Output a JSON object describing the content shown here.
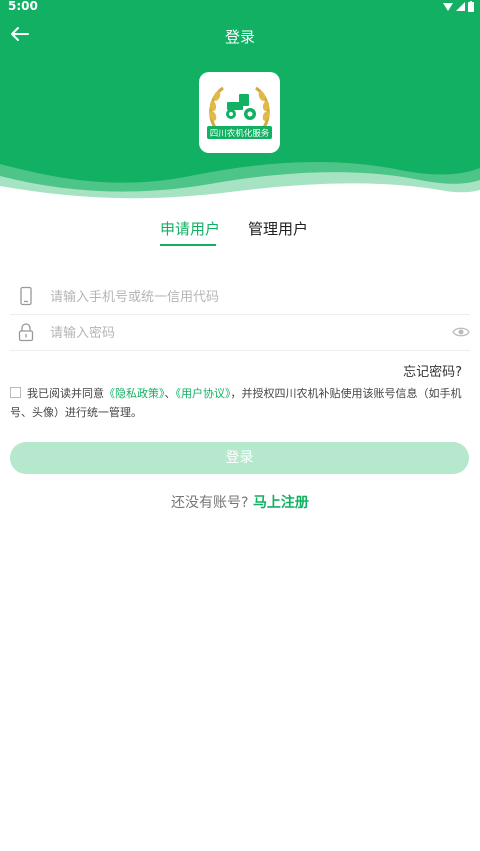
{
  "status_bar": {
    "time": "5:00"
  },
  "header": {
    "title": "登录"
  },
  "logo": {
    "text": "四川农机化服务"
  },
  "tabs": [
    {
      "label": "申请用户"
    },
    {
      "label": "管理用户"
    }
  ],
  "form": {
    "phone_placeholder": "请输入手机号或统一信用代码",
    "password_placeholder": "请输入密码",
    "forgot_label": "忘记密码?"
  },
  "agreement": {
    "prefix": "我已阅读并同意",
    "privacy_link": "《隐私政策》",
    "separator": "、",
    "user_link": "《用户协议》",
    "suffix": "，并授权四川农机补贴使用该账号信息（如手机号、头像）进行统一管理。"
  },
  "login_button": "登录",
  "register": {
    "prompt": "还没有账号?",
    "link": "马上注册"
  },
  "colors": {
    "brand": "#12b063",
    "button_disabled": "#b6e8cd"
  }
}
